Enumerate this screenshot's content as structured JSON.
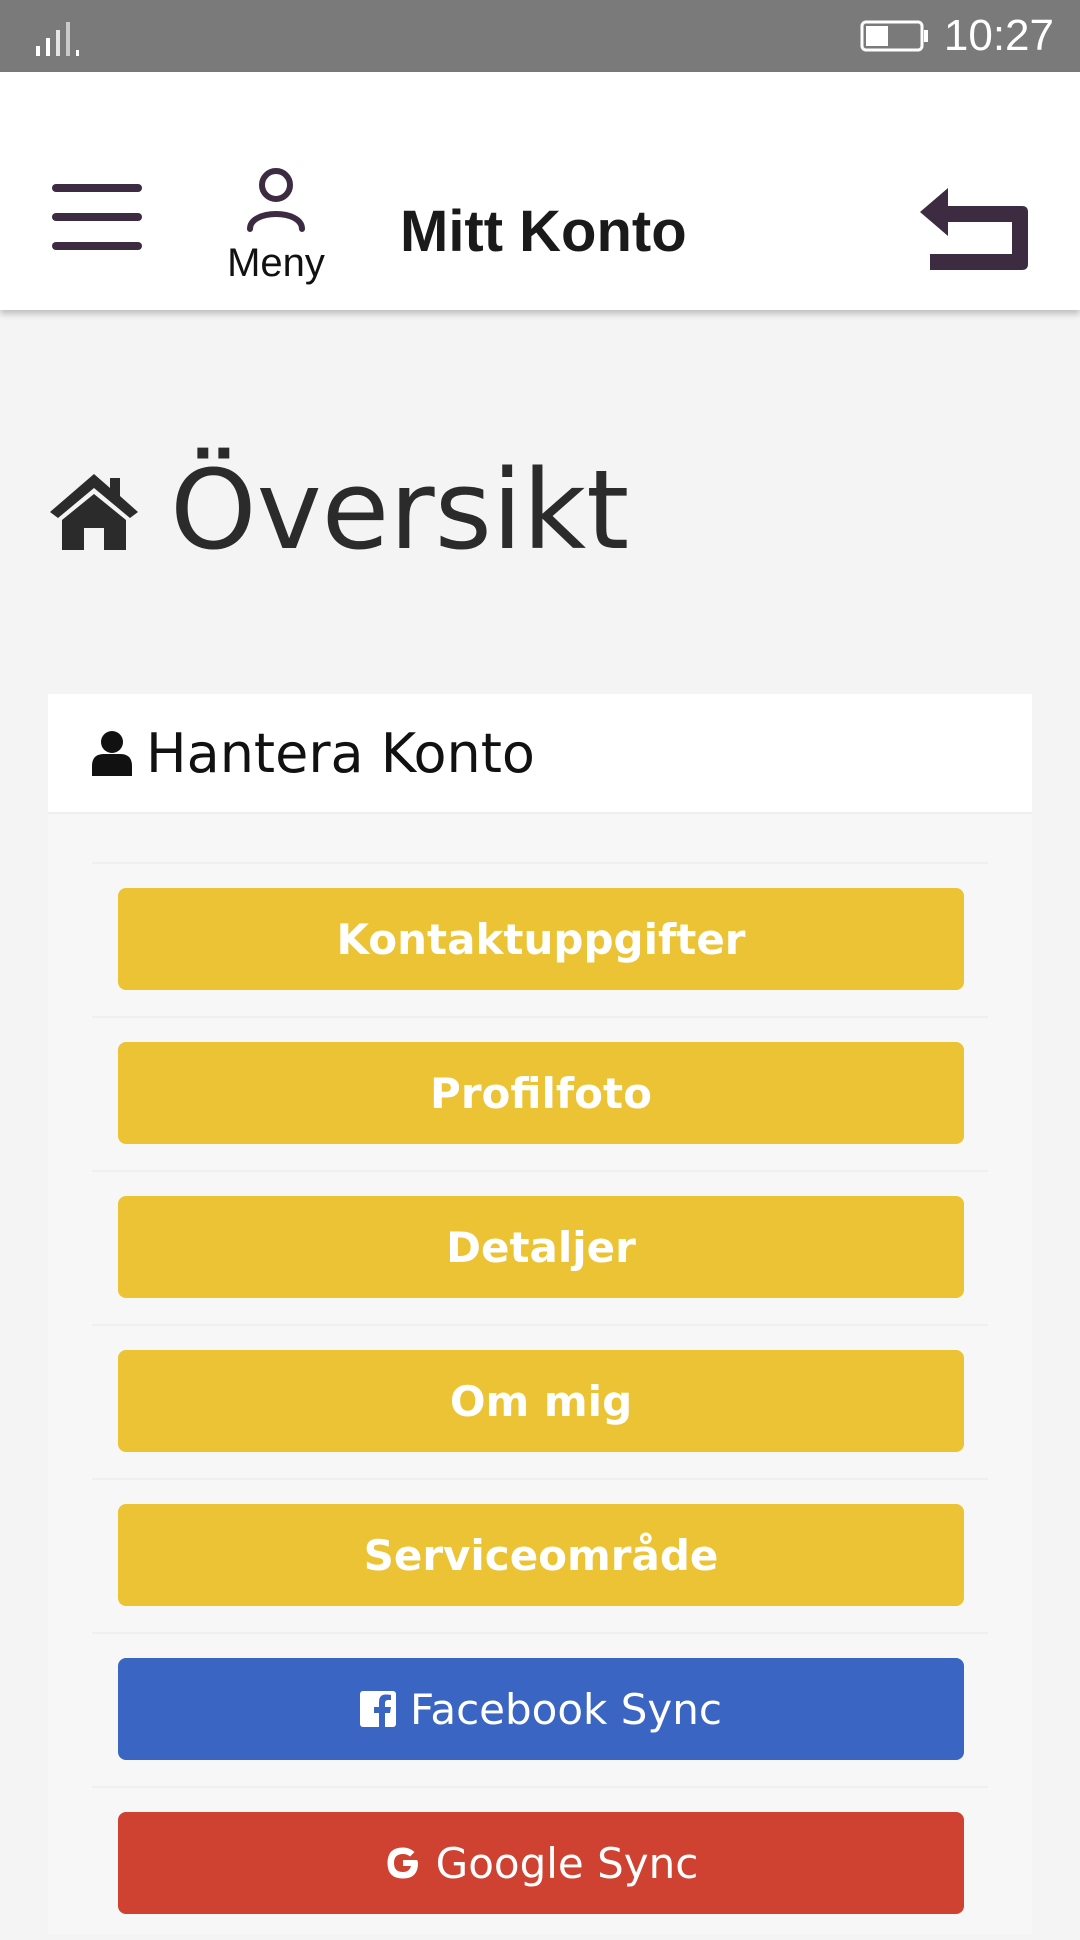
{
  "status_bar": {
    "time": "10:27"
  },
  "header": {
    "menu_label": "Meny",
    "title": "Mitt Konto"
  },
  "page": {
    "title": "Översikt"
  },
  "card": {
    "title": "Hantera Konto",
    "buttons": [
      {
        "label": "Kontaktuppgifter",
        "color": "#ebc334"
      },
      {
        "label": "Profilfoto",
        "color": "#ebc334"
      },
      {
        "label": "Detaljer",
        "color": "#ebc334"
      },
      {
        "label": "Om mig",
        "color": "#ebc334"
      },
      {
        "label": "Serviceområde",
        "color": "#ebc334"
      },
      {
        "label": "Facebook Sync",
        "color": "#3b65c3",
        "icon": "facebook-icon"
      },
      {
        "label": "Google Sync",
        "color": "#cf4232",
        "icon": "google-icon"
      }
    ]
  },
  "colors": {
    "accent_dark": "#3d2b41",
    "status_bar": "#7a7a7a"
  }
}
